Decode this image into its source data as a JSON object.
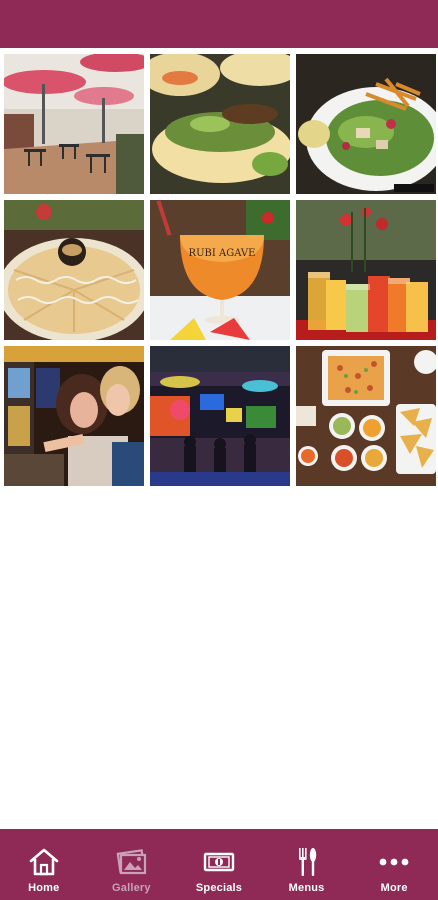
{
  "colors": {
    "brand": "#8e2a55",
    "tab_active": "#ffffff",
    "tab_inactive": "#c9a3b5"
  },
  "gallery": {
    "photos": [
      {
        "name": "patio-photo"
      },
      {
        "name": "tacos-photo"
      },
      {
        "name": "salad-photo"
      },
      {
        "name": "quesadilla-photo"
      },
      {
        "name": "cocktail-photo",
        "caption": "RUBI AGAVE"
      },
      {
        "name": "drinks-photo"
      },
      {
        "name": "slot-machines-photo"
      },
      {
        "name": "bar-interior-photo"
      },
      {
        "name": "appetizers-photo"
      }
    ]
  },
  "tabs": [
    {
      "label": "Home",
      "icon": "home-icon",
      "active": true
    },
    {
      "label": "Gallery",
      "icon": "gallery-icon",
      "active": false
    },
    {
      "label": "Specials",
      "icon": "specials-icon",
      "active": true
    },
    {
      "label": "Menus",
      "icon": "menus-icon",
      "active": true
    },
    {
      "label": "More",
      "icon": "more-icon",
      "active": true
    }
  ]
}
